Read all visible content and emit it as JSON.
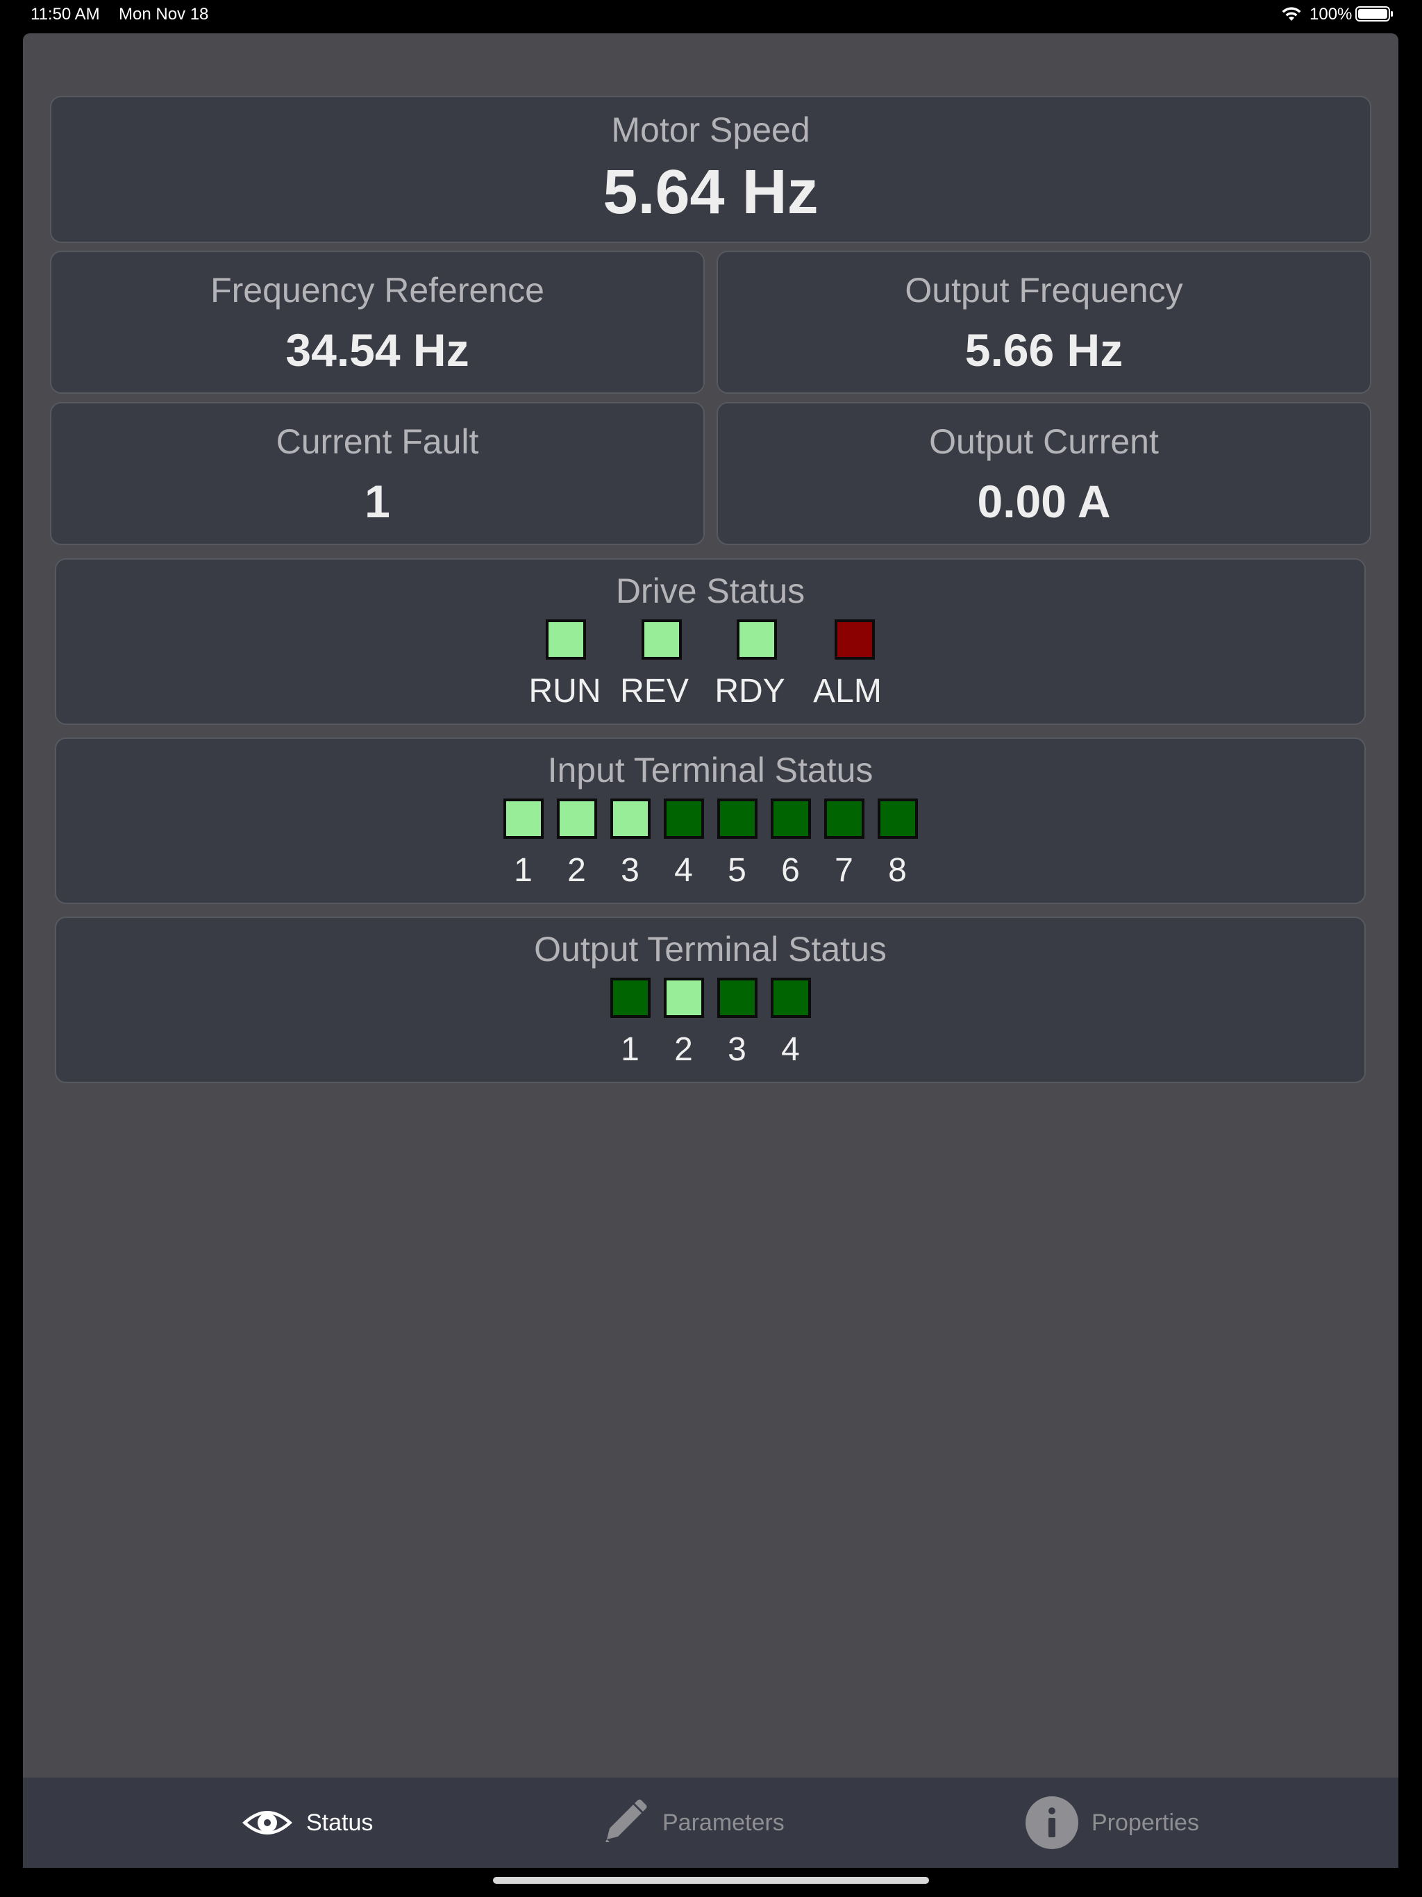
{
  "status_bar": {
    "time": "11:50 AM",
    "date": "Mon Nov 18",
    "battery_percent": "100%",
    "battery_level": 1.0,
    "wifi_icon": "wifi-icon",
    "battery_icon": "battery-icon"
  },
  "motor_speed": {
    "label": "Motor Speed",
    "value": "5.64 Hz"
  },
  "frequency_reference": {
    "label": "Frequency Reference",
    "value": "34.54 Hz"
  },
  "output_frequency": {
    "label": "Output Frequency",
    "value": "5.66 Hz"
  },
  "current_fault": {
    "label": "Current Fault",
    "value": "1"
  },
  "output_current": {
    "label": "Output Current",
    "value": "0.00 A"
  },
  "drive_status": {
    "title": "Drive Status",
    "indicators": [
      {
        "label": "RUN",
        "state": "on"
      },
      {
        "label": "REV",
        "state": "on"
      },
      {
        "label": "RDY",
        "state": "on"
      },
      {
        "label": "ALM",
        "state": "alarm"
      }
    ]
  },
  "input_terminal_status": {
    "title": "Input Terminal Status",
    "terminals": [
      {
        "label": "1",
        "state": "on"
      },
      {
        "label": "2",
        "state": "on"
      },
      {
        "label": "3",
        "state": "on"
      },
      {
        "label": "4",
        "state": "off"
      },
      {
        "label": "5",
        "state": "off"
      },
      {
        "label": "6",
        "state": "off"
      },
      {
        "label": "7",
        "state": "off"
      },
      {
        "label": "8",
        "state": "off"
      }
    ]
  },
  "output_terminal_status": {
    "title": "Output Terminal Status",
    "terminals": [
      {
        "label": "1",
        "state": "off"
      },
      {
        "label": "2",
        "state": "on"
      },
      {
        "label": "3",
        "state": "off"
      },
      {
        "label": "4",
        "state": "off"
      }
    ]
  },
  "tab_bar": {
    "tabs": [
      {
        "label": "Status",
        "icon": "eye-icon",
        "selected": true
      },
      {
        "label": "Parameters",
        "icon": "pencil-icon",
        "selected": false
      },
      {
        "label": "Properties",
        "icon": "info-icon",
        "selected": false
      }
    ]
  },
  "colors": {
    "led_on": "#98ee98",
    "led_off": "#006400",
    "led_alarm": "#8b0000",
    "tab_selected": "#ffffff",
    "tab_unselected": "#8e8e93"
  }
}
